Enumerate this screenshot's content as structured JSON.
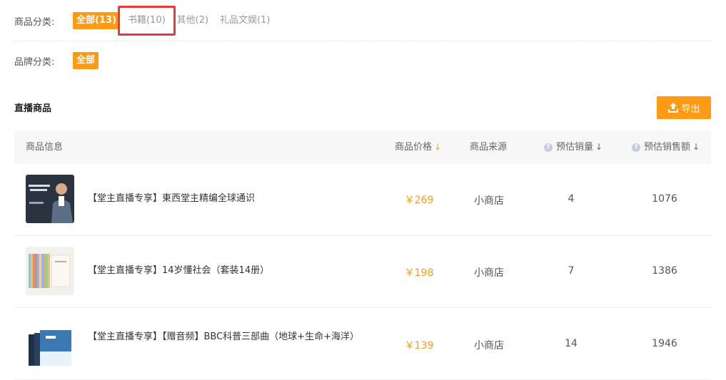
{
  "filters": {
    "category_label": "商品分类:",
    "categories": [
      "全部(13)",
      "书籍(10)",
      "其他(2)",
      "礼品文娱(1)"
    ],
    "brand_label": "品牌分类:",
    "brands": [
      "全部"
    ]
  },
  "section": {
    "title": "直播商品",
    "export_label": "导出"
  },
  "table": {
    "headers": {
      "info": "商品信息",
      "price": "商品价格",
      "source": "商品来源",
      "sales": "预估销量",
      "revenue": "预估销售额"
    },
    "rows": [
      {
        "title": "【堂主直播专享】東西堂主精编全球通识",
        "price": "￥269",
        "source": "小商店",
        "sales": "4",
        "revenue": "1076"
      },
      {
        "title": "【堂主直播专享】14岁懂社会（套装14册）",
        "price": "￥198",
        "source": "小商店",
        "sales": "7",
        "revenue": "1386"
      },
      {
        "title": "【堂主直播专享】【赠音频】BBC科普三部曲（地球+生命+海洋）",
        "price": "￥139",
        "source": "小商店",
        "sales": "14",
        "revenue": "1946"
      }
    ]
  },
  "colors": {
    "accent": "#ff9a14",
    "highlight_border": "#e23b3b"
  },
  "icons": {
    "export": "upload-icon",
    "help": "question-icon",
    "sort": "sort-down-arrow-icon"
  }
}
